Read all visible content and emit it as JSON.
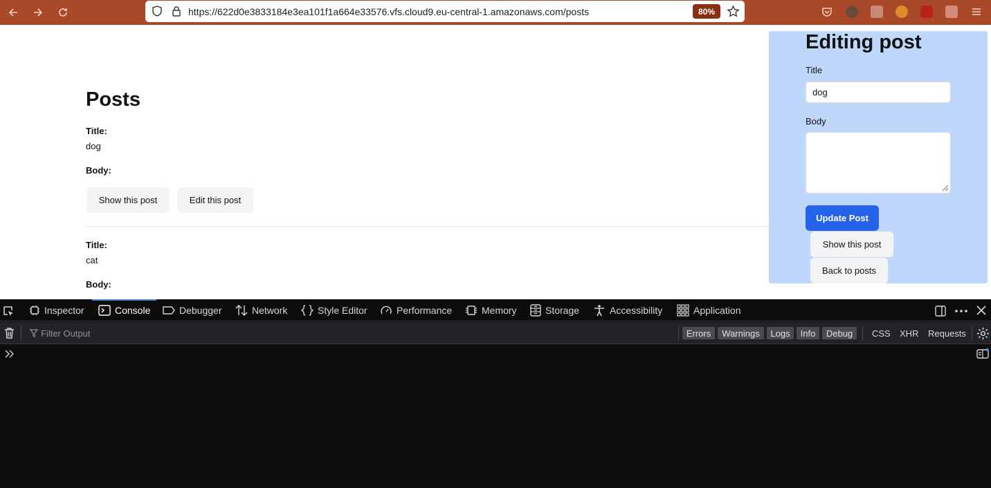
{
  "browser": {
    "url": "https://622d0e3833184e3ea101f1a664e33576.vfs.cloud9.eu-central-1.amazonaws.com/posts",
    "zoom": "80%",
    "toolbar_color": "#a9492a"
  },
  "page": {
    "title": "Posts",
    "posts": [
      {
        "title_label": "Title:",
        "title": "dog",
        "body_label": "Body:",
        "show_button": "Show this post",
        "edit_button": "Edit this post"
      },
      {
        "title_label": "Title:",
        "title": "cat",
        "body_label": "Body:"
      }
    ]
  },
  "edit_panel": {
    "heading": "Editing post",
    "title_label": "Title",
    "title_value": "dog",
    "body_label": "Body",
    "body_value": "",
    "submit_button": "Update Post",
    "show_button": "Show this post",
    "back_button": "Back to posts",
    "background": "#bfd7fb",
    "accent": "#2563eb"
  },
  "devtools": {
    "tabs": [
      {
        "label": "Inspector"
      },
      {
        "label": "Console"
      },
      {
        "label": "Debugger"
      },
      {
        "label": "Network"
      },
      {
        "label": "Style Editor"
      },
      {
        "label": "Performance"
      },
      {
        "label": "Memory"
      },
      {
        "label": "Storage"
      },
      {
        "label": "Accessibility"
      },
      {
        "label": "Application"
      }
    ],
    "active_tab": "Console",
    "filter_placeholder": "Filter Output",
    "level_filters": [
      "Errors",
      "Warnings",
      "Logs",
      "Info",
      "Debug"
    ],
    "type_filters": [
      "CSS",
      "XHR",
      "Requests"
    ]
  }
}
